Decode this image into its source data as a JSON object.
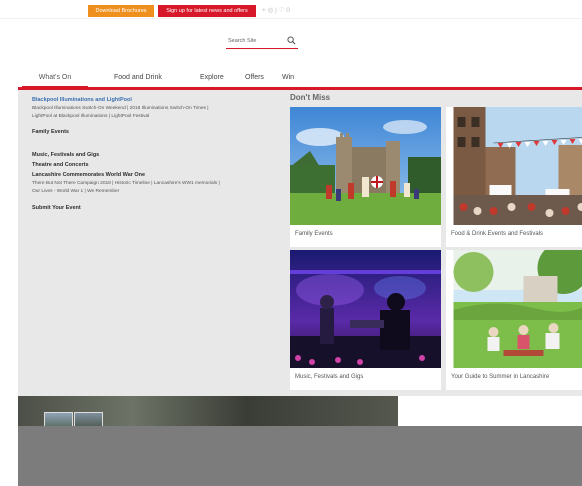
{
  "topbar": {
    "brochure_label": "Download Brochures",
    "signup_label": "Sign up for latest news and offers",
    "social_text": "+ ◎  |  ♡ 0"
  },
  "search": {
    "placeholder": "Search Site"
  },
  "nav": {
    "tabs": [
      {
        "label": "What's On",
        "active": true
      },
      {
        "label": "Food and Drink"
      },
      {
        "label": "Explore"
      },
      {
        "label": "Offers"
      },
      {
        "label": "Win"
      }
    ]
  },
  "menu": {
    "sections": [
      {
        "title": "Blackpool Illuminations and LightPool",
        "sub": [
          "Blackpool Illuminations Switch-On Weekend | 2018 Illuminations Switch-On Times |",
          "LightPool at Blackpool Illuminations | LightPool Festival"
        ]
      },
      {
        "title": "Family Events",
        "sub": []
      },
      {
        "title": "Music, Festivals and Gigs",
        "sub": []
      },
      {
        "title": "Theatre and Concerts",
        "sub": []
      },
      {
        "title": "Lancashire Commemorates World War One",
        "sub": [
          "There But Not There Campaign 2018 | Historic Timeline | Lancashire's WW1 memorials |",
          "Our Lives - World War 1 | We Remember"
        ]
      },
      {
        "title": "Submit Your Event",
        "sub": []
      }
    ]
  },
  "dont_miss": {
    "heading": "Don't Miss",
    "cards": [
      {
        "caption": "Family Events"
      },
      {
        "caption": "Food & Drink Events and Festivals"
      },
      {
        "caption": "Music, Festivals and Gigs"
      },
      {
        "caption": "Your Guide to Summer in Lancashire"
      }
    ]
  },
  "colors": {
    "accent": "#d7182a",
    "orange": "#ef8f1e",
    "link_blue": "#3a6fb0",
    "panel_bg": "#e8e8e8"
  }
}
